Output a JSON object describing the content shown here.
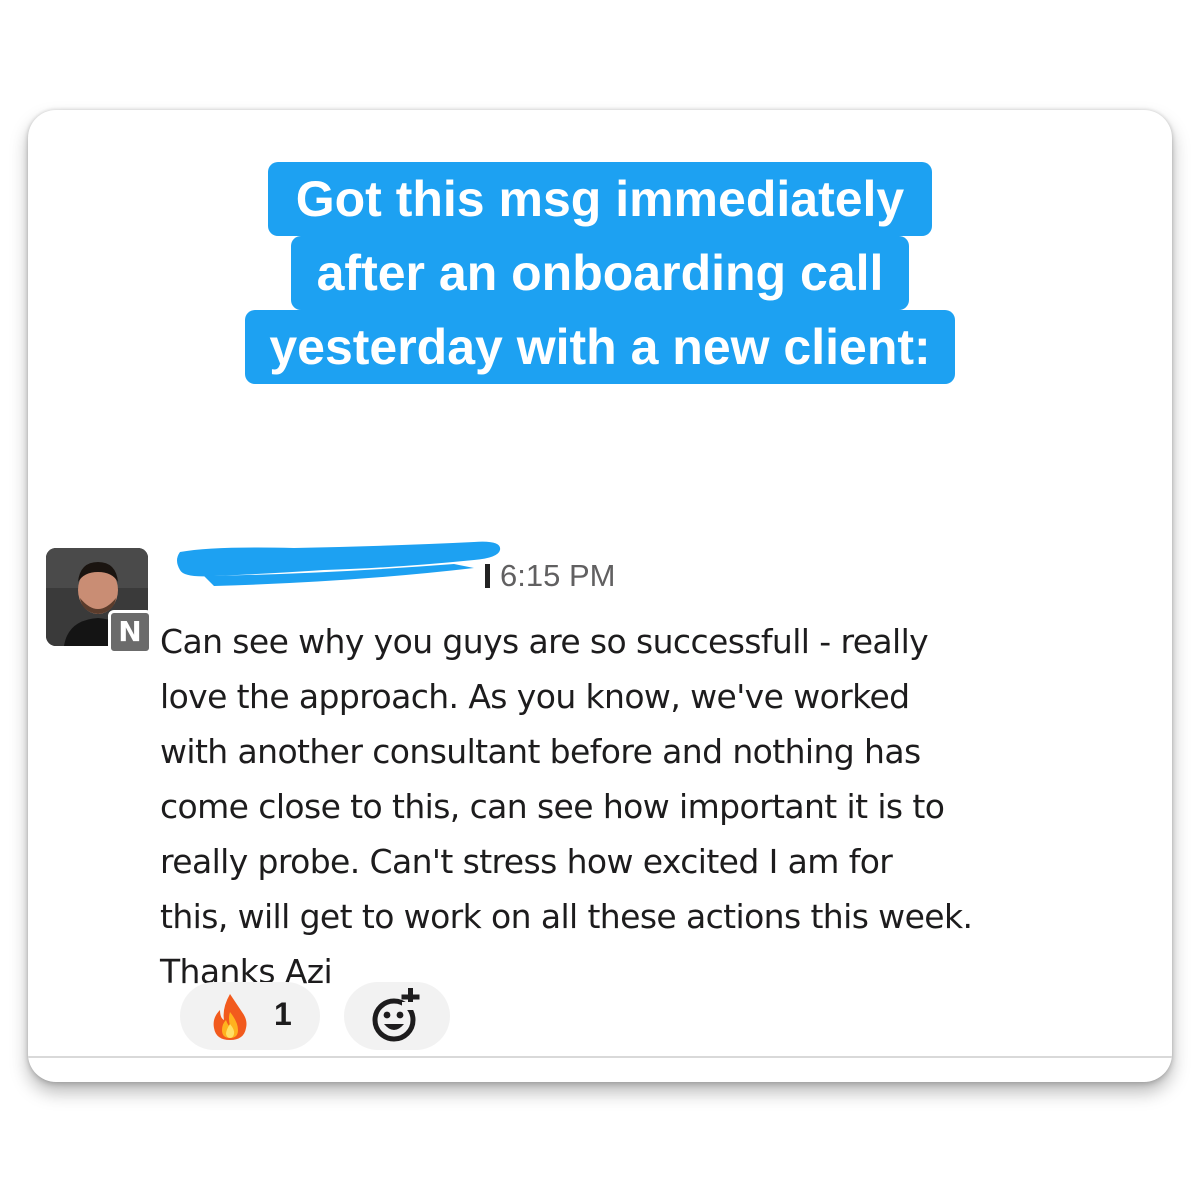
{
  "caption": {
    "lines": [
      "Got this msg immediately",
      "after an onboarding call",
      "yesterday with a new client:"
    ],
    "highlight_color": "#1da1f2",
    "text_color": "#ffffff"
  },
  "message": {
    "avatar_badge": "N",
    "sender_redacted": true,
    "timestamp": "6:15 PM",
    "body_lines": [
      "Can see why you guys are so successfull - really",
      "love the approach. As you know, we've worked",
      "with another consultant before and nothing has",
      "come close to this, can see how important it is to",
      "really probe. Can't stress how excited I am for",
      "this, will get to work on all these actions this week.",
      "Thanks Azi"
    ]
  },
  "reactions": [
    {
      "emoji_icon": "fire-icon",
      "count": "1"
    }
  ],
  "add_reaction": {
    "icon": "add-emoji-icon"
  }
}
